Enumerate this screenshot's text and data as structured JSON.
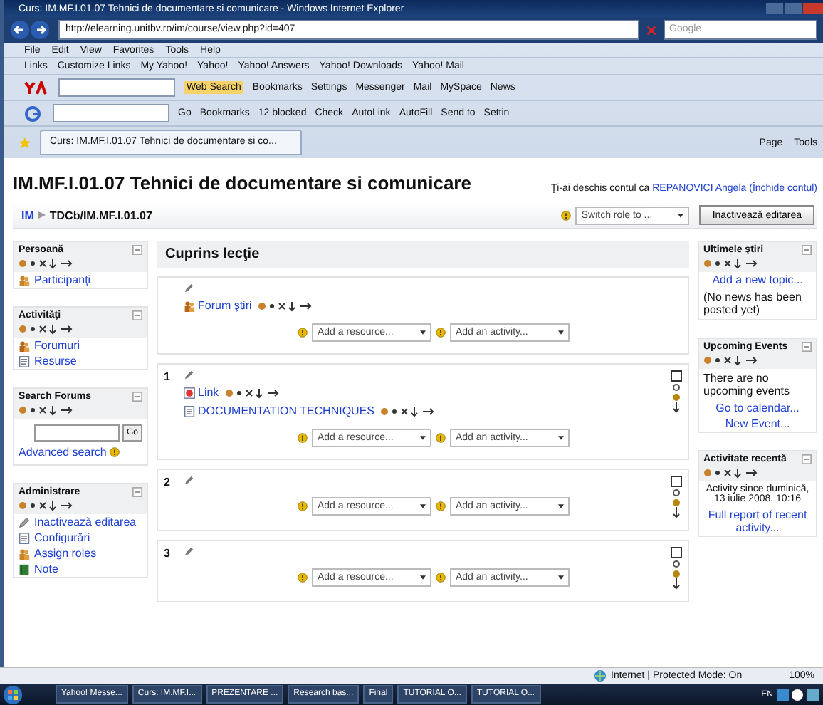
{
  "window": {
    "title": "Curs: IM.MF.I.01.07 Tehnici de documentare si comunicare - Windows Internet Explorer"
  },
  "address_bar": {
    "url": "http://elearning.unitbv.ro/im/course/view.php?id=407",
    "search_placeholder": "Google"
  },
  "menu": [
    "File",
    "Edit",
    "View",
    "Favorites",
    "Tools",
    "Help"
  ],
  "links_bar": {
    "label": "Links",
    "items": [
      "Customize Links",
      "My Yahoo!",
      "Yahoo!",
      "Yahoo! Answers",
      "Yahoo! Downloads",
      "Yahoo! Mail"
    ]
  },
  "yahoo_toolbar": {
    "items": [
      "Web Search",
      "Bookmarks",
      "Settings",
      "Messenger",
      "Mail",
      "MySpace",
      "News"
    ]
  },
  "google_toolbar": {
    "items": [
      "Go",
      "Bookmarks",
      "12 blocked",
      "Check",
      "AutoLink",
      "AutoFill",
      "Send to"
    ],
    "settings": "Settin"
  },
  "tab": {
    "title": "Curs: IM.MF.I.01.07 Tehnici de documentare si co..."
  },
  "command_bar": [
    "Page",
    "Tools"
  ],
  "page": {
    "title": "IM.MF.I.01.07 Tehnici de documentare si comunicare",
    "login_text": "Ţi-ai deschis contul ca",
    "user": "REPANOVICI Angela",
    "logout": "(Închide contul)",
    "breadcrumb": [
      "IM",
      "TDCb/IM.MF.I.01.07"
    ],
    "switch_role": "Switch role to ...",
    "edit_button": "Inactivează editarea"
  },
  "left_blocks": [
    {
      "title": "Persoană",
      "kind": "links",
      "items": [
        {
          "label": "Participanţi",
          "kind": "people"
        }
      ]
    },
    {
      "title": "Activităţi",
      "kind": "links",
      "items": [
        {
          "label": "Forumuri",
          "kind": "forum"
        },
        {
          "label": "Resurse",
          "kind": "resource"
        }
      ]
    },
    {
      "title": "Search Forums",
      "kind": "search",
      "go": "Go",
      "link": "Advanced search"
    },
    {
      "title": "Administrare",
      "kind": "links",
      "items": [
        {
          "label": "Inactivează editarea",
          "kind": "edit"
        },
        {
          "label": "Configurări",
          "kind": "resource"
        },
        {
          "label": "Assign roles",
          "kind": "people"
        },
        {
          "label": "Note",
          "kind": "grades"
        }
      ]
    }
  ],
  "main": {
    "title": "Cuprins lecţie",
    "sections": [
      {
        "items": [
          {
            "label": "Forum ştiri",
            "kind": "forum"
          }
        ],
        "add_resource": "Add a resource...",
        "add_activity": "Add an activity..."
      },
      {
        "number": "1",
        "items": [
          {
            "label": "Link",
            "kind": "link"
          },
          {
            "label": "DOCUMENTATION TECHNIQUES",
            "kind": "resource"
          }
        ],
        "add_resource": "Add a resource...",
        "add_activity": "Add an activity..."
      },
      {
        "number": "2",
        "add_resource": "Add a resource...",
        "add_activity": "Add an activity..."
      },
      {
        "number": "3",
        "add_resource": "Add a resource...",
        "add_activity": "Add an activity..."
      }
    ]
  },
  "right_blocks": [
    {
      "title": "Ultimele ştiri",
      "lines": [
        {
          "kind": "link",
          "text": "Add a new topic..."
        },
        {
          "kind": "text",
          "text": "(No news has been posted yet)"
        }
      ]
    },
    {
      "title": "Upcoming Events",
      "lines": [
        {
          "kind": "text",
          "text": "There are no upcoming events"
        },
        {
          "kind": "link",
          "text": "Go to calendar..."
        },
        {
          "kind": "link",
          "text": "New Event..."
        }
      ]
    },
    {
      "title": "Activitate recentă",
      "lines": [
        {
          "kind": "note",
          "text": "Activity since duminică, 13 iulie 2008, 10:16"
        },
        {
          "kind": "link",
          "text": "Full report of recent activity..."
        }
      ]
    }
  ],
  "status_bar": {
    "zone": "Internet | Protected Mode: On",
    "zoom": "100%"
  },
  "taskbar": {
    "items": [
      "Yahoo! Messe...",
      "Curs: IM.MF.I...",
      "PREZENTARE ...",
      "Research bas...",
      "Final",
      "TUTORIAL O...",
      "TUTORIAL O..."
    ],
    "language": "EN"
  }
}
